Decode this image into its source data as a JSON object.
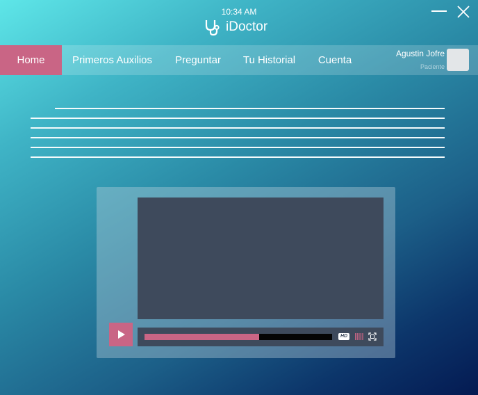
{
  "status": {
    "time": "10:34 AM"
  },
  "app": {
    "name": "iDoctor",
    "logo_icon": "stethoscope-icon"
  },
  "window": {
    "minimize_icon": "minimize-icon",
    "close_icon": "close-icon"
  },
  "nav": {
    "items": [
      {
        "label": "Home",
        "active": true
      },
      {
        "label": "Primeros Auxilios",
        "active": false
      },
      {
        "label": "Preguntar",
        "active": false
      },
      {
        "label": "Tu Historial",
        "active": false
      },
      {
        "label": "Cuenta",
        "active": false
      }
    ]
  },
  "user": {
    "name": "Agustin Jofre",
    "role": "Paciente"
  },
  "video": {
    "progress": 0.61,
    "hd_label": "HD",
    "play_icon": "play-icon",
    "volume_icon": "volume-icon",
    "fullscreen_icon": "fullscreen-icon"
  },
  "colors": {
    "accent": "#c96585",
    "video_bg": "#3e4a5c",
    "nav_bg": "rgba(255,255,255,0.18)"
  }
}
